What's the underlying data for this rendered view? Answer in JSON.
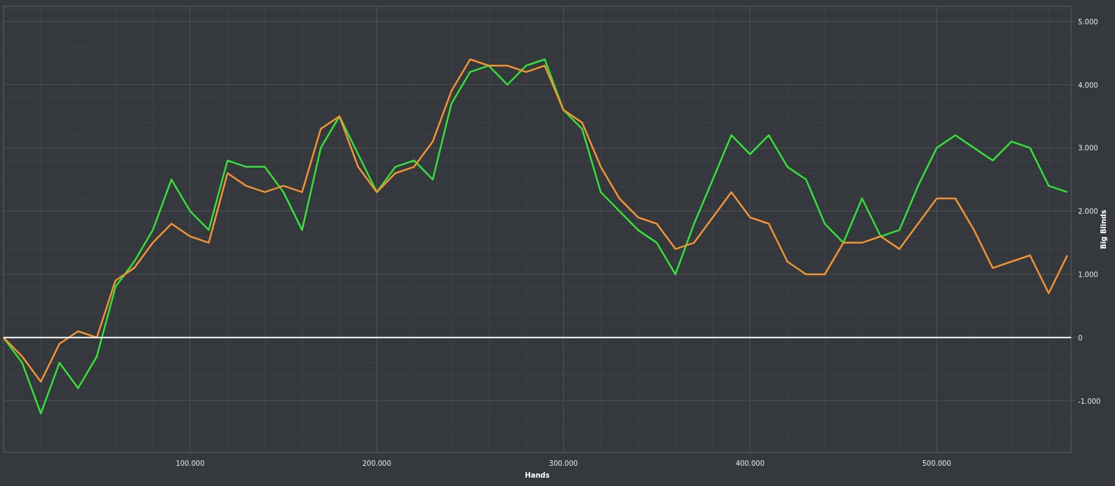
{
  "chart_data": {
    "type": "line",
    "grid": true,
    "xlabel": "Hands",
    "ylabel": "Big Blinds",
    "x": [
      0,
      10000,
      20000,
      30000,
      40000,
      50000,
      60000,
      70000,
      80000,
      90000,
      100000,
      110000,
      120000,
      130000,
      140000,
      150000,
      160000,
      170000,
      180000,
      190000,
      200000,
      210000,
      220000,
      230000,
      240000,
      250000,
      260000,
      270000,
      280000,
      290000,
      300000,
      310000,
      320000,
      330000,
      340000,
      350000,
      360000,
      370000,
      380000,
      390000,
      400000,
      410000,
      420000,
      430000,
      440000,
      450000,
      460000,
      470000,
      480000,
      490000,
      500000,
      510000,
      520000,
      530000,
      540000,
      550000,
      560000,
      570000
    ],
    "series": [
      {
        "color": "#33e13a",
        "values": [
          0,
          -400,
          -1200,
          -400,
          -800,
          -300,
          800,
          1200,
          1700,
          2500,
          2000,
          1700,
          2800,
          2700,
          2700,
          2300,
          1700,
          3000,
          3500,
          2900,
          2300,
          2700,
          2800,
          2500,
          3700,
          4200,
          4300,
          4000,
          4300,
          4400,
          3600,
          3300,
          2300,
          2000,
          1700,
          1500,
          1000,
          1800,
          2500,
          3200,
          2900,
          3200,
          2700,
          2500,
          1800,
          1500,
          2200,
          1600,
          1700,
          2400,
          3000,
          3200,
          3000,
          2800,
          3100,
          3000,
          2400,
          2300
        ]
      },
      {
        "color": "#f39433",
        "values": [
          0,
          -300,
          -700,
          -100,
          100,
          0,
          900,
          1100,
          1500,
          1800,
          1600,
          1500,
          2600,
          2400,
          2300,
          2400,
          2300,
          3300,
          3500,
          2700,
          2300,
          2600,
          2700,
          3100,
          3900,
          4400,
          4300,
          4300,
          4200,
          4300,
          3600,
          3400,
          2700,
          2200,
          1900,
          1800,
          1400,
          1500,
          1900,
          2300,
          1900,
          1800,
          1200,
          1000,
          1000,
          1500,
          1500,
          1600,
          1400,
          1800,
          2200,
          2200,
          1700,
          1100,
          1200,
          1300,
          700,
          1300
        ]
      }
    ],
    "xlim": [
      0,
      572000
    ],
    "ylim": [
      -1820,
      5240
    ],
    "xticks": [
      {
        "value": 100000,
        "label": "100.000"
      },
      {
        "value": 200000,
        "label": "200.000"
      },
      {
        "value": 300000,
        "label": "300.000"
      },
      {
        "value": 400000,
        "label": "400.000"
      },
      {
        "value": 500000,
        "label": "500.000"
      }
    ],
    "yticks": [
      {
        "value": -1000,
        "label": "-1.000"
      },
      {
        "value": 0,
        "label": "0"
      },
      {
        "value": 1000,
        "label": "1.000"
      },
      {
        "value": 2000,
        "label": "2.000"
      },
      {
        "value": 3000,
        "label": "3.000"
      },
      {
        "value": 4000,
        "label": "4.000"
      },
      {
        "value": 5000,
        "label": "5.000"
      }
    ]
  }
}
